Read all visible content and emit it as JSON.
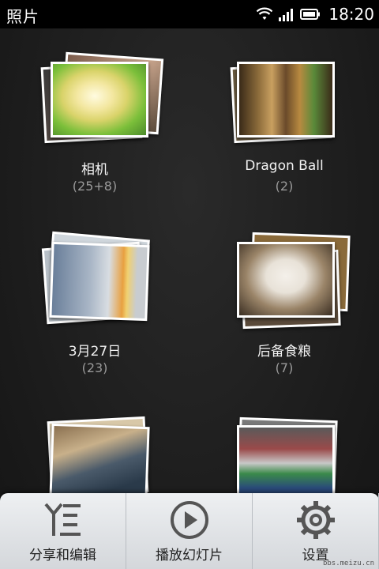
{
  "statusbar": {
    "app_title": "照片",
    "time": "18:20",
    "icons": [
      "wifi-icon",
      "signal-icon",
      "battery-icon"
    ]
  },
  "albums": [
    {
      "name": "相机",
      "count": "(25+8)"
    },
    {
      "name": "Dragon Ball",
      "count": "(2)"
    },
    {
      "name": "3月27日",
      "count": "(23)"
    },
    {
      "name": "后备食粮",
      "count": "(7)"
    },
    {
      "name": "",
      "count": ""
    },
    {
      "name": "",
      "count": ""
    }
  ],
  "toolbar": {
    "share_edit_label": "分享和编辑",
    "slideshow_label": "播放幻灯片",
    "settings_label": "设置"
  },
  "watermark": "bbs.meizu.cn"
}
